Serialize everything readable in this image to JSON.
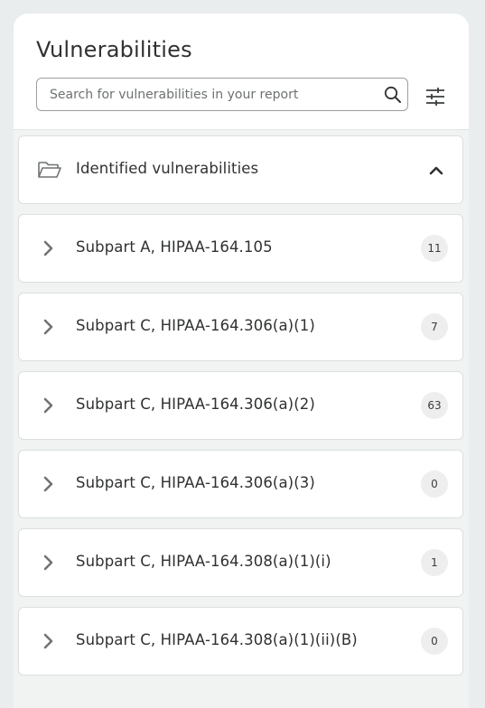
{
  "panel": {
    "title": "Vulnerabilities",
    "search": {
      "placeholder": "Search for vulnerabilities in your report",
      "value": ""
    },
    "icons": {
      "search": "search-icon",
      "filter": "sliders-icon"
    }
  },
  "section": {
    "label": "Identified vulnerabilities",
    "icon": "folder-open-icon",
    "expanded": true
  },
  "items": [
    {
      "label": "Subpart A, HIPAA-164.105",
      "count": "11"
    },
    {
      "label": "Subpart C, HIPAA-164.306(a)(1)",
      "count": "7"
    },
    {
      "label": "Subpart C, HIPAA-164.306(a)(2)",
      "count": "63"
    },
    {
      "label": "Subpart C, HIPAA-164.306(a)(3)",
      "count": "0"
    },
    {
      "label": "Subpart C, HIPAA-164.308(a)(1)(i)",
      "count": "1"
    },
    {
      "label": "Subpart C, HIPAA-164.308(a)(1)(ii)(B)",
      "count": "0"
    }
  ],
  "colors": {
    "background": "#e9eded",
    "panel": "#ffffff",
    "text": "#2f3230",
    "icon": "#6f7472",
    "badge": "#eeeeee"
  }
}
